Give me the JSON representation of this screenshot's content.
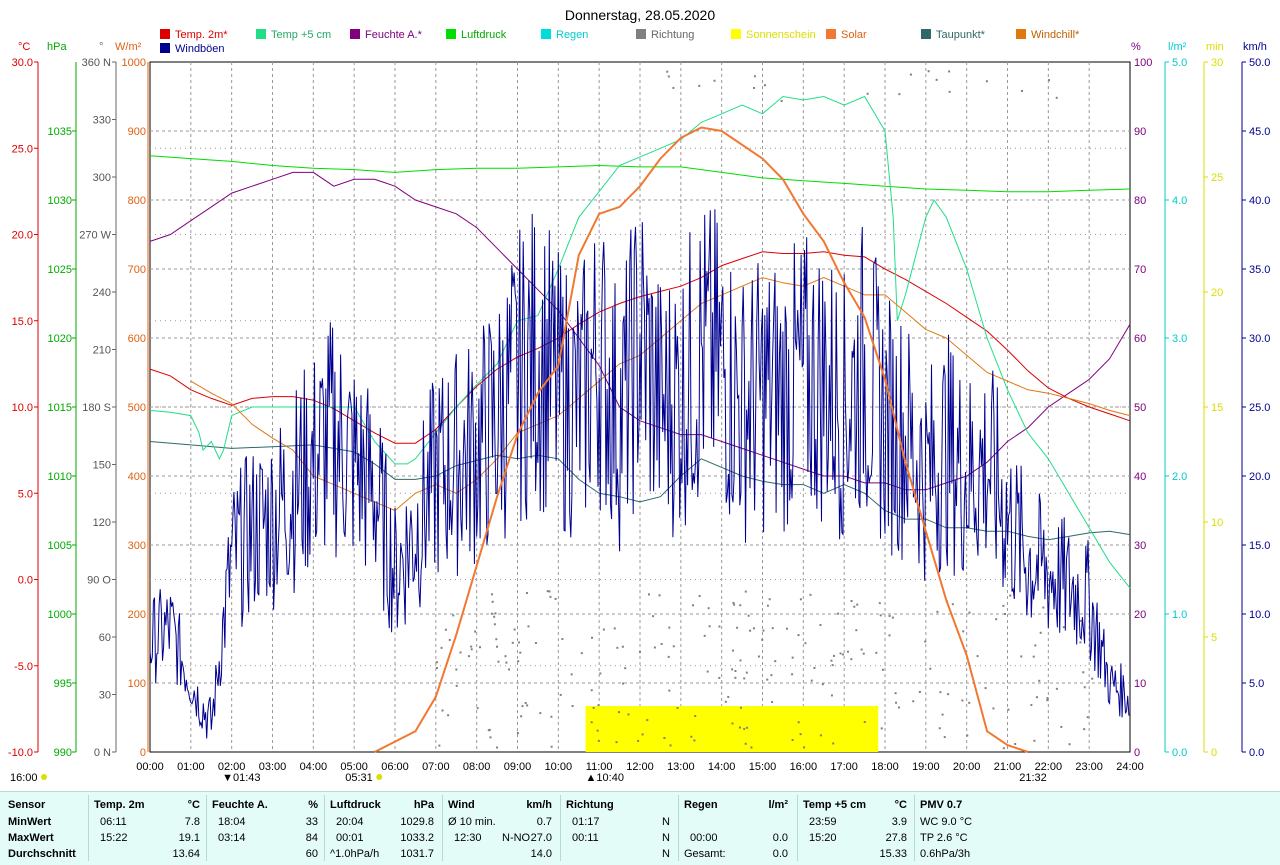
{
  "title": "Donnerstag, 28.05.2020",
  "colors": {
    "temp2m": "#dd0000",
    "temp5cm": "#22dd88",
    "humidity": "#800080",
    "pressure": "#00dd00",
    "rain": "#00dddd",
    "direction": "#808080",
    "sunshine": "#ffff00",
    "solar": "#f07830",
    "dewpoint": "#306868",
    "windchill": "#e07810",
    "gusts": "#000090"
  },
  "legend": [
    {
      "label": "Temp. 2m*",
      "color": "#dd0000",
      "text_color": "#dd0000"
    },
    {
      "label": "Temp +5 cm",
      "color": "#22dd88",
      "text_color": "#22aa66"
    },
    {
      "label": "Feuchte A.*",
      "color": "#800080",
      "text_color": "#800080"
    },
    {
      "label": "Luftdruck",
      "color": "#00dd00",
      "text_color": "#00aa00"
    },
    {
      "label": "Regen",
      "color": "#00dddd",
      "text_color": "#00cccc"
    },
    {
      "label": "Richtung",
      "color": "#808080",
      "text_color": "#666666"
    },
    {
      "label": "Sonnenschein",
      "color": "#ffff00",
      "text_color": "#dddd00"
    },
    {
      "label": "Solar",
      "color": "#f07830",
      "text_color": "#e06010"
    },
    {
      "label": "Taupunkt*",
      "color": "#306868",
      "text_color": "#306868"
    },
    {
      "label": "Windchill*",
      "color": "#e07810",
      "text_color": "#c06000"
    },
    {
      "label": "Windböen",
      "color": "#000090",
      "text_color": "#000090"
    }
  ],
  "axes": {
    "units": {
      "temp": "°C",
      "press": "hPa",
      "dir": "°",
      "solar": "W/m²",
      "hum": "%",
      "rain": "l/m²",
      "min": "min",
      "wind": "km/h"
    },
    "temp_ticks": [
      "30.0",
      "25.0",
      "20.0",
      "15.0",
      "10.0",
      "5.0",
      "0.0",
      "-5.0",
      "-10.0"
    ],
    "press_ticks": [
      "1035",
      "1030",
      "1025",
      "1020",
      "1015",
      "1010",
      "1005",
      "1000",
      "995",
      "990"
    ],
    "dir_ticks": [
      "360 N",
      "330",
      "300",
      "270 W",
      "240",
      "210",
      "180 S",
      "150",
      "120",
      "90 O",
      "60",
      "30",
      "0 N"
    ],
    "solar_ticks": [
      "1000",
      "900",
      "800",
      "700",
      "600",
      "500",
      "400",
      "300",
      "200",
      "100",
      "0"
    ],
    "hum_ticks": [
      "100",
      "90",
      "80",
      "70",
      "60",
      "50",
      "40",
      "30",
      "20",
      "10",
      "0"
    ],
    "rain_ticks": [
      "5.0",
      "4.0",
      "3.0",
      "2.0",
      "1.0",
      "0.0"
    ],
    "min_ticks": [
      "30",
      "25",
      "20",
      "15",
      "10",
      "5",
      "0"
    ],
    "wind_ticks": [
      "50.0",
      "45.0",
      "40.0",
      "35.0",
      "30.0",
      "25.0",
      "20.0",
      "15.0",
      "10.0",
      "5.0",
      "0.0"
    ],
    "hours": [
      "00:00",
      "01:00",
      "02:00",
      "03:00",
      "04:00",
      "05:00",
      "06:00",
      "07:00",
      "08:00",
      "09:00",
      "10:00",
      "11:00",
      "12:00",
      "13:00",
      "14:00",
      "15:00",
      "16:00",
      "17:00",
      "18:00",
      "19:00",
      "20:00",
      "21:00",
      "22:00",
      "23:00",
      "24:00"
    ],
    "markers": {
      "moonrise": "16:00",
      "moonset": "01:43",
      "sunrise": "05:31",
      "noon": "10:40",
      "sunset": "21:32"
    }
  },
  "chart_data": {
    "type": "line",
    "title": "Donnerstag, 28.05.2020",
    "x_unit": "hours",
    "xlim": [
      0,
      24
    ],
    "series": [
      {
        "name": "Temp. 2m*",
        "axis": "°C",
        "ylim": [
          -10,
          30
        ],
        "x": [
          0,
          0.5,
          1,
          1.5,
          2,
          2.5,
          3,
          3.5,
          4,
          4.5,
          5,
          5.5,
          6,
          6.5,
          7,
          7.5,
          8,
          8.5,
          9,
          9.5,
          10,
          10.5,
          11,
          11.5,
          12,
          12.5,
          13,
          13.5,
          14,
          14.5,
          15,
          15.5,
          16,
          16.5,
          17,
          17.5,
          18,
          18.5,
          19,
          19.5,
          20,
          20.5,
          21,
          21.5,
          22,
          22.5,
          23,
          23.5,
          24
        ],
        "values": [
          12.2,
          11.8,
          11.0,
          10.5,
          10.1,
          10.5,
          10.6,
          10.6,
          10.4,
          9.9,
          9.2,
          8.5,
          7.9,
          7.9,
          8.7,
          10.0,
          11.2,
          12.2,
          12.9,
          13.4,
          14.0,
          14.8,
          15.5,
          16.0,
          16.4,
          16.7,
          17.0,
          17.5,
          18.2,
          18.6,
          19.0,
          18.9,
          18.9,
          19.0,
          18.8,
          18.7,
          18.0,
          17.4,
          16.7,
          16.0,
          15.2,
          14.4,
          13.3,
          12.1,
          11.1,
          10.5,
          10.0,
          9.6,
          9.2
        ]
      },
      {
        "name": "Temp +5 cm",
        "axis": "°C",
        "ylim": [
          -10,
          30
        ],
        "x": [
          0,
          0.5,
          1,
          1.2,
          1.3,
          1.5,
          1.7,
          1.8,
          2.0,
          2.5,
          3,
          3.5,
          4,
          4.5,
          5,
          5.5,
          6,
          6.3,
          6.5,
          7,
          7.5,
          8,
          8.5,
          9,
          9.5,
          10,
          10.5,
          11,
          11.5,
          12,
          12.5,
          13,
          13.5,
          14,
          14.5,
          15,
          15.5,
          16,
          16.5,
          17,
          17.5,
          18,
          18.2,
          18.3,
          18.5,
          19,
          19.2,
          19.5,
          20,
          20.5,
          21,
          21.5,
          22,
          22.5,
          23,
          23.5,
          24
        ],
        "values": [
          9.8,
          9.7,
          9.5,
          8.5,
          7.5,
          8.0,
          7.0,
          7.5,
          9.5,
          10.0,
          10.0,
          10.0,
          10.0,
          10.0,
          10.0,
          8.0,
          6.7,
          6.7,
          7.0,
          8.5,
          10.0,
          11.3,
          12.5,
          15.0,
          15.3,
          18.0,
          21.0,
          22.5,
          24.0,
          24.5,
          25.0,
          25.5,
          26.5,
          27.0,
          27.5,
          27.0,
          28.0,
          27.8,
          28.0,
          27.5,
          28.0,
          26.0,
          21.0,
          15.0,
          16.5,
          21.0,
          22.0,
          21.0,
          18.0,
          14.0,
          11.0,
          8.5,
          7.0,
          5.0,
          3.0,
          1.0,
          -0.5
        ]
      },
      {
        "name": "Feuchte A.*",
        "axis": "%",
        "ylim": [
          0,
          100
        ],
        "x": [
          0,
          0.5,
          1,
          1.5,
          2,
          2.5,
          3,
          3.5,
          4,
          4.5,
          5,
          5.5,
          6,
          6.5,
          7,
          7.5,
          8,
          8.5,
          9,
          9.5,
          10,
          10.5,
          11,
          11.5,
          12,
          12.5,
          13,
          13.5,
          14,
          14.5,
          15,
          15.5,
          16,
          16.5,
          17,
          17.5,
          18,
          18.5,
          19,
          19.5,
          20,
          20.5,
          21,
          21.5,
          22,
          22.5,
          23,
          23.5,
          24
        ],
        "values": [
          74,
          75,
          77,
          79,
          81,
          82,
          83,
          84,
          84,
          82,
          83,
          83,
          82,
          80,
          79,
          78,
          76,
          73,
          70,
          67,
          64,
          60,
          56,
          50,
          48,
          47,
          46,
          46,
          45,
          44,
          43,
          42,
          41,
          40,
          40,
          39,
          39,
          38,
          38,
          39,
          40,
          42,
          45,
          47,
          50,
          52,
          54,
          57,
          62
        ]
      },
      {
        "name": "Luftdruck",
        "axis": "hPa",
        "ylim": [
          990,
          1040
        ],
        "x": [
          0,
          1,
          2,
          3,
          4,
          5,
          6,
          7,
          8,
          9,
          10,
          11,
          12,
          13,
          14,
          15,
          16,
          17,
          18,
          19,
          20,
          21,
          22,
          23,
          24
        ],
        "values": [
          1033.2,
          1033.0,
          1032.8,
          1032.5,
          1032.3,
          1032.2,
          1032.0,
          1032.2,
          1032.3,
          1032.3,
          1032.4,
          1032.5,
          1032.4,
          1032.4,
          1032.0,
          1031.6,
          1031.4,
          1031.2,
          1031.0,
          1030.8,
          1030.7,
          1030.6,
          1030.6,
          1030.7,
          1030.8
        ]
      },
      {
        "name": "Solar",
        "axis": "W/m²",
        "ylim": [
          0,
          1000
        ],
        "x": [
          5.5,
          6,
          6.5,
          7,
          7.5,
          8,
          8.5,
          9,
          9.5,
          10,
          10.5,
          11,
          11.5,
          12,
          12.5,
          13,
          13.5,
          14,
          14.5,
          15,
          15.5,
          16,
          16.5,
          17,
          17.5,
          18,
          18.5,
          19,
          19.5,
          20,
          20.5,
          21,
          21.5
        ],
        "values": [
          0,
          15,
          30,
          80,
          170,
          270,
          370,
          460,
          520,
          560,
          720,
          780,
          790,
          820,
          860,
          890,
          905,
          900,
          880,
          860,
          830,
          780,
          740,
          680,
          630,
          540,
          420,
          320,
          220,
          140,
          30,
          10,
          0
        ]
      },
      {
        "name": "Taupunkt*",
        "axis": "°C",
        "ylim": [
          -10,
          30
        ],
        "x": [
          0,
          1,
          2,
          3,
          4,
          5,
          5.5,
          6,
          6.5,
          7,
          7.5,
          8,
          8.5,
          9,
          9.5,
          10,
          10.5,
          11,
          11.5,
          12,
          12.5,
          13,
          13.5,
          14,
          14.5,
          15,
          15.5,
          16,
          16.5,
          17,
          17.5,
          18,
          18.5,
          19,
          19.5,
          20,
          20.5,
          21,
          21.5,
          22,
          22.5,
          23,
          23.5,
          24
        ],
        "values": [
          8.0,
          7.8,
          7.6,
          7.7,
          7.8,
          7.4,
          6.7,
          5.8,
          5.8,
          6.0,
          6.6,
          6.9,
          7.2,
          7.0,
          7.2,
          7.0,
          5.8,
          5.0,
          4.8,
          4.5,
          4.8,
          6.0,
          7.0,
          6.5,
          6.0,
          5.7,
          5.5,
          5.5,
          5.0,
          5.5,
          5.0,
          4.0,
          3.5,
          3.5,
          3.0,
          3.0,
          2.8,
          2.8,
          2.5,
          2.3,
          2.5,
          2.7,
          2.8,
          2.6
        ]
      },
      {
        "name": "Windchill*",
        "axis": "°C",
        "ylim": [
          -10,
          30
        ],
        "x": [
          1,
          1.5,
          2,
          2.5,
          3,
          3.5,
          4,
          4.5,
          5,
          5.5,
          6,
          6.5,
          7,
          7.5,
          8,
          8.5,
          9,
          9.5,
          10,
          10.5,
          11,
          11.5,
          12,
          12.5,
          13,
          13.5,
          14,
          14.5,
          15,
          15.5,
          16,
          16.5,
          17,
          17.5,
          18,
          18.5,
          19,
          19.5,
          20,
          20.5,
          21,
          21.5,
          22,
          22.5,
          23,
          23.5,
          24
        ],
        "values": [
          11.5,
          10.8,
          10.2,
          9.0,
          8.2,
          7.5,
          6.0,
          5.5,
          5.0,
          4.5,
          4.0,
          5.0,
          5.5,
          5.0,
          5.8,
          7.0,
          8.5,
          9.0,
          9.5,
          10.5,
          11.5,
          12.5,
          13.0,
          14.0,
          15.0,
          16.0,
          16.5,
          17.0,
          17.5,
          17.2,
          17.0,
          17.5,
          17.0,
          16.5,
          16.5,
          15.5,
          14.5,
          14.0,
          13.0,
          12.0,
          11.5,
          11.0,
          10.8,
          10.5,
          10.2,
          9.8,
          9.5
        ]
      },
      {
        "name": "Windböen",
        "axis": "km/h",
        "ylim": [
          0,
          50
        ],
        "x": [
          0,
          0.5,
          1,
          1.5,
          2,
          2.5,
          3,
          3.5,
          4,
          4.5,
          5,
          5.5,
          6,
          6.5,
          7,
          7.5,
          8,
          8.5,
          9,
          9.5,
          10,
          10.5,
          11,
          11.5,
          12,
          12.5,
          13,
          13.5,
          14,
          14.5,
          15,
          15.5,
          16,
          16.5,
          17,
          17.5,
          18,
          18.5,
          19,
          19.5,
          20,
          20.5,
          21,
          21.5,
          22,
          22.5,
          23,
          23.5,
          24
        ],
        "values": [
          8,
          9,
          5,
          2,
          14,
          16,
          17,
          19,
          21,
          23,
          21,
          19,
          13,
          16,
          20,
          21,
          22,
          24,
          27,
          29,
          26,
          25,
          29,
          24,
          30,
          25,
          26,
          29,
          28,
          25,
          26,
          26,
          27,
          27,
          25,
          28,
          24,
          23,
          20,
          22,
          20,
          21,
          17,
          14,
          13,
          12,
          11,
          5,
          4
        ]
      }
    ],
    "sunshine_period": [
      "10:40",
      "17:50"
    ]
  },
  "table": {
    "row_labels": [
      "Sensor",
      "MinWert",
      "MaxWert",
      "Durchschnitt"
    ],
    "temp2m": {
      "name": "Temp. 2m",
      "unit": "°C",
      "min_time": "06:11",
      "min_val": "7.8",
      "max_time": "15:22",
      "max_val": "19.1",
      "avg_val": "13.64"
    },
    "humidity": {
      "name": "Feuchte A.",
      "unit": "%",
      "min_time": "18:04",
      "min_val": "33",
      "max_time": "03:14",
      "max_val": "84",
      "avg_val": "60"
    },
    "pressure": {
      "name": "Luftdruck",
      "unit": "hPa",
      "min_time": "20:04",
      "min_val": "1029.8",
      "max_time": "00:01",
      "max_val": "1033.2",
      "trend": "^1.0hPa/h",
      "avg_val": "1031.7"
    },
    "wind": {
      "name": "Wind",
      "unit": "km/h",
      "min_label": "Ø 10 min.",
      "min_val": "0.7",
      "max_time": "12:30",
      "max_dir": "N-NO",
      "max_val": "27.0",
      "avg_val": "14.0"
    },
    "direction": {
      "name": "Richtung",
      "min_time": "01:17",
      "min_val": "N",
      "max_time": "00:11",
      "max_val": "N",
      "avg_val": "N"
    },
    "rain": {
      "name": "Regen",
      "unit": "l/m²",
      "max_time": "00:00",
      "max_val": "0.0",
      "total_label": "Gesamt:",
      "total_val": "0.0"
    },
    "temp5cm": {
      "name": "Temp +5 cm",
      "unit": "°C",
      "min_time": "23:59",
      "min_val": "3.9",
      "max_time": "15:20",
      "max_val": "27.8",
      "avg_val": "15.33"
    },
    "pmv": {
      "name": "PMV 0.7",
      "wc": "WC 9.0 °C",
      "tp": "TP 2.6 °C",
      "trend": "0.6hPa/3h"
    }
  }
}
